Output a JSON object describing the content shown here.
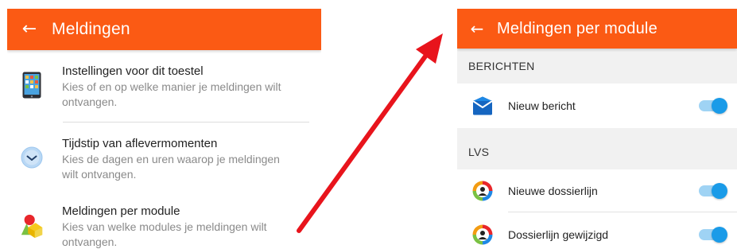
{
  "left_screen": {
    "title": "Meldingen",
    "back_icon": "arrow-left-icon",
    "items": [
      {
        "icon": "tablet-icon",
        "title": "Instellingen voor dit toestel",
        "desc_line1": "Kies of en op welke manier je meldingen wilt",
        "desc_line2": "ontvangen."
      },
      {
        "icon": "clock-icon",
        "title": "Tijdstip van aflevermomenten",
        "desc_line1": "Kies de dagen en uren waarop je meldingen",
        "desc_line2": "wilt ontvangen."
      },
      {
        "icon": "shapes-icon",
        "title": "Meldingen per module",
        "desc_line1": "Kies van welke modules je meldingen wilt",
        "desc_line2": "ontvangen."
      }
    ]
  },
  "right_screen": {
    "title": "Meldingen per module",
    "back_icon": "arrow-left-icon",
    "sections": [
      {
        "header": "BERICHTEN",
        "rows": [
          {
            "icon": "envelope-icon",
            "label": "Nieuw bericht",
            "enabled": true
          }
        ]
      },
      {
        "header": "LVS",
        "rows": [
          {
            "icon": "student-file-icon",
            "label": "Nieuwe dossierlijn",
            "enabled": true
          },
          {
            "icon": "student-file-icon",
            "label": "Dossierlijn gewijzigd",
            "enabled": true
          }
        ]
      }
    ]
  },
  "colors": {
    "app_bar": "#fb5a14",
    "toggle_on": "#1a9be8",
    "arrow": "#e8141c"
  }
}
